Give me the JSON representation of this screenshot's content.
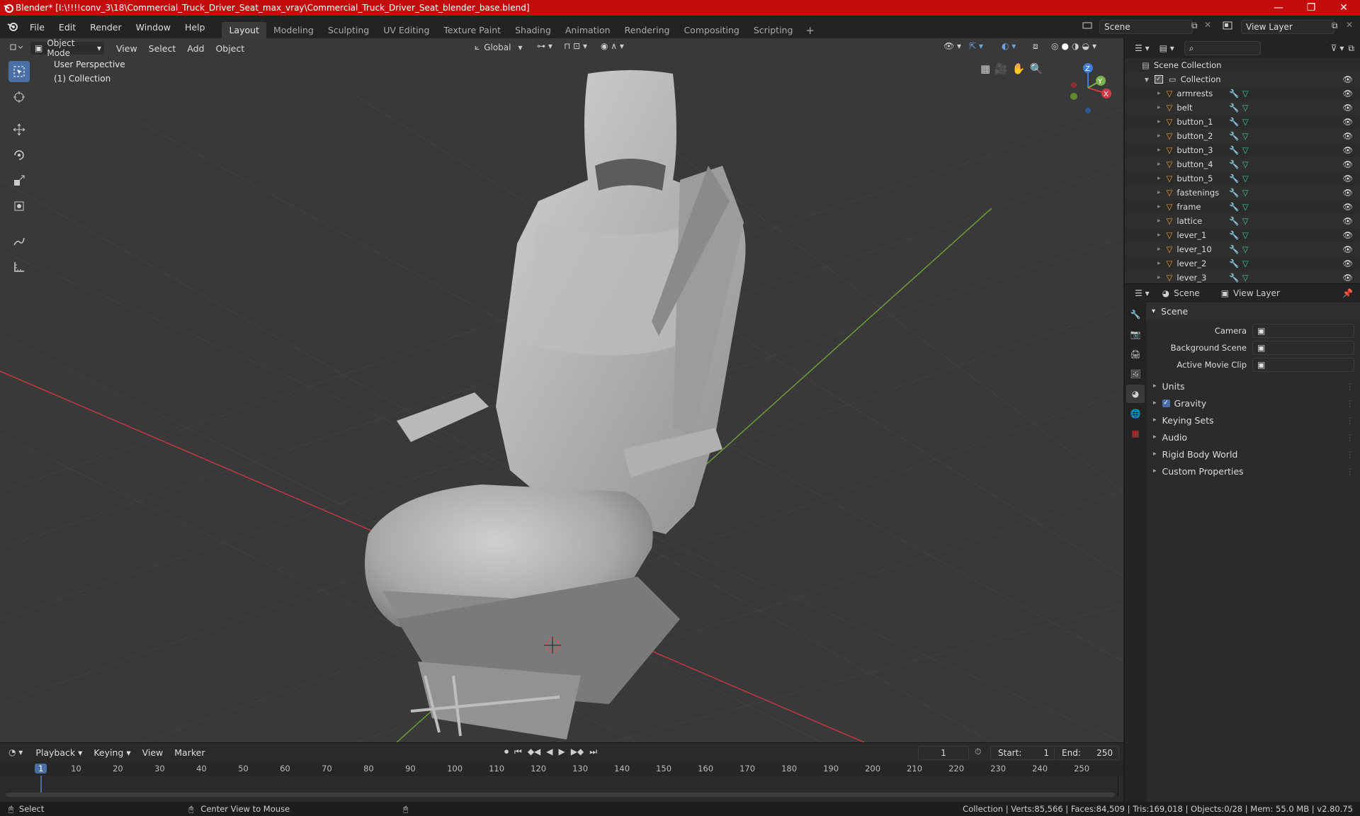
{
  "title_bar": {
    "title": "Blender* [I:\\!!!!conv_3\\18\\Commercial_Truck_Driver_Seat_max_vray\\Commercial_Truck_Driver_Seat_blender_base.blend]"
  },
  "menu": [
    "File",
    "Edit",
    "Render",
    "Window",
    "Help"
  ],
  "workspaces": [
    "Layout",
    "Modeling",
    "Sculpting",
    "UV Editing",
    "Texture Paint",
    "Shading",
    "Animation",
    "Rendering",
    "Compositing",
    "Scripting"
  ],
  "active_workspace": "Layout",
  "scene_field": "Scene",
  "view_layer_field": "View Layer",
  "viewport": {
    "mode": "Object Mode",
    "menus": [
      "View",
      "Select",
      "Add",
      "Object"
    ],
    "orientation": "Global",
    "overlay_line1": "User Perspective",
    "overlay_line2": "(1) Collection",
    "gizmo_axes": {
      "x": "X",
      "y": "Y",
      "z": "Z"
    }
  },
  "outliner": {
    "root": "Scene Collection",
    "collection": "Collection",
    "objects": [
      "armrests",
      "belt",
      "button_1",
      "button_2",
      "button_3",
      "button_4",
      "button_5",
      "fastenings",
      "frame",
      "lattice",
      "lever_1",
      "lever_10",
      "lever_2",
      "lever_3"
    ]
  },
  "properties": {
    "tabs": [
      "Scene",
      "View Layer"
    ],
    "panel_title": "Scene",
    "fields": [
      {
        "label": "Camera",
        "value": ""
      },
      {
        "label": "Background Scene",
        "value": ""
      },
      {
        "label": "Active Movie Clip",
        "value": ""
      }
    ],
    "sections": [
      "Units",
      "Gravity",
      "Keying Sets",
      "Audio",
      "Rigid Body World",
      "Custom Properties"
    ],
    "gravity_checked": true
  },
  "timeline": {
    "menus": [
      "Playback",
      "Keying",
      "View",
      "Marker"
    ],
    "current_frame": "1",
    "start_label": "Start:",
    "start": "1",
    "end_label": "End:",
    "end": "250",
    "ruler": [
      "1",
      "10",
      "20",
      "30",
      "40",
      "50",
      "60",
      "70",
      "80",
      "90",
      "100",
      "110",
      "120",
      "130",
      "140",
      "150",
      "160",
      "170",
      "180",
      "190",
      "200",
      "210",
      "220",
      "230",
      "240",
      "250"
    ]
  },
  "status_bar": {
    "left": "Select",
    "middle": "Center View to Mouse",
    "right": "Collection | Verts:85,566 | Faces:84,509 | Tris:169,018 | Objects:0/28 | Mem: 55.0 MB | v2.80.75"
  },
  "colors": {
    "title_bar": "#c30d0d",
    "accent": "#4a6fa5",
    "x_axis": "#d23a44",
    "y_axis": "#7cb24a",
    "z_axis": "#3d7fd6"
  }
}
